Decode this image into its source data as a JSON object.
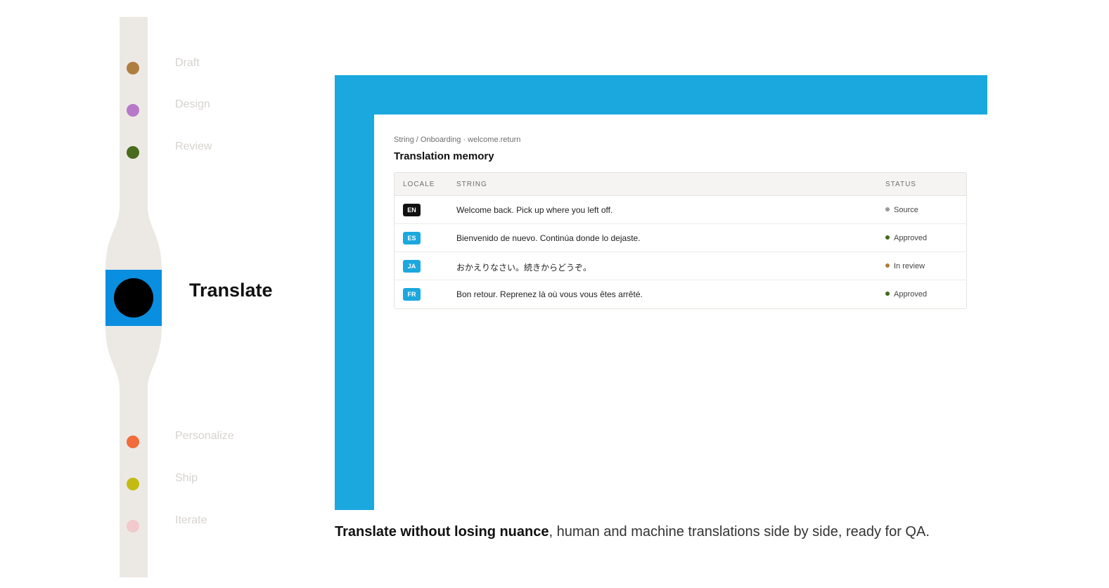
{
  "timeline": {
    "steps": [
      {
        "label": "Draft",
        "color": "#b07d40"
      },
      {
        "label": "Design",
        "color": "#b878c9"
      },
      {
        "label": "Review",
        "color": "#4a6b1e"
      },
      {
        "label": "Translate",
        "color": "#000000"
      },
      {
        "label": "Personalize",
        "color": "#f26b3a"
      },
      {
        "label": "Ship",
        "color": "#c3bb12"
      },
      {
        "label": "Iterate",
        "color": "#f2c9cc"
      }
    ],
    "active_label": "Translate",
    "active_color": "#0a8ee0"
  },
  "panel": {
    "breadcrumb": "String / Onboarding · welcome.return",
    "title": "Translation memory",
    "columns": {
      "locale": "LOCALE",
      "string": "STRING",
      "status": "STATUS"
    },
    "rows": [
      {
        "locale": "EN",
        "text": "Welcome back. Pick up where you left off.",
        "status": "Source",
        "badge_color": "#111111",
        "status_color": "#9a9a9a"
      },
      {
        "locale": "ES",
        "text": "Bienvenido de nuevo. Continúa donde lo dejaste.",
        "status": "Approved",
        "badge_color": "#1ba8de",
        "status_color": "#3f6b1f"
      },
      {
        "locale": "JA",
        "text": "おかえりなさい。続きからどうぞ。",
        "status": "In review",
        "badge_color": "#1ba8de",
        "status_color": "#b07d40"
      },
      {
        "locale": "FR",
        "text": "Bon retour. Reprenez là où vous vous êtes arrêté.",
        "status": "Approved",
        "badge_color": "#1ba8de",
        "status_color": "#3f6b1f"
      }
    ]
  },
  "caption": {
    "bold": "Translate without losing nuance",
    "rest": ", human and machine translations side by side, ready for QA."
  },
  "colors": {
    "frame": "#1ba8de",
    "rail": "#ece9e5"
  }
}
